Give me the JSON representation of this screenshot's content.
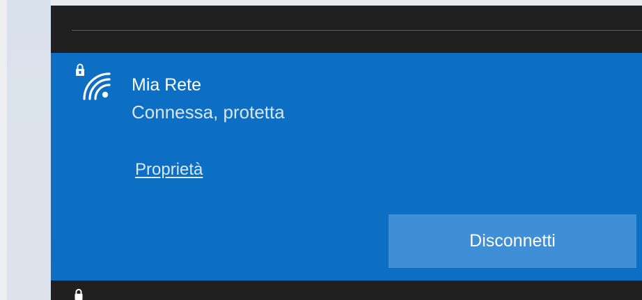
{
  "network": {
    "name": "Mia Rete",
    "status": "Connessa, protetta",
    "properties_link": "Proprietà",
    "disconnect_label": "Disconnetti",
    "icon": "wifi-secured-icon"
  },
  "next_network": {
    "icon": "lock-icon"
  },
  "colors": {
    "flyout_bg": "#202020",
    "selected_bg": "#0c6fc4",
    "button_bg": "#3e8fd6"
  }
}
